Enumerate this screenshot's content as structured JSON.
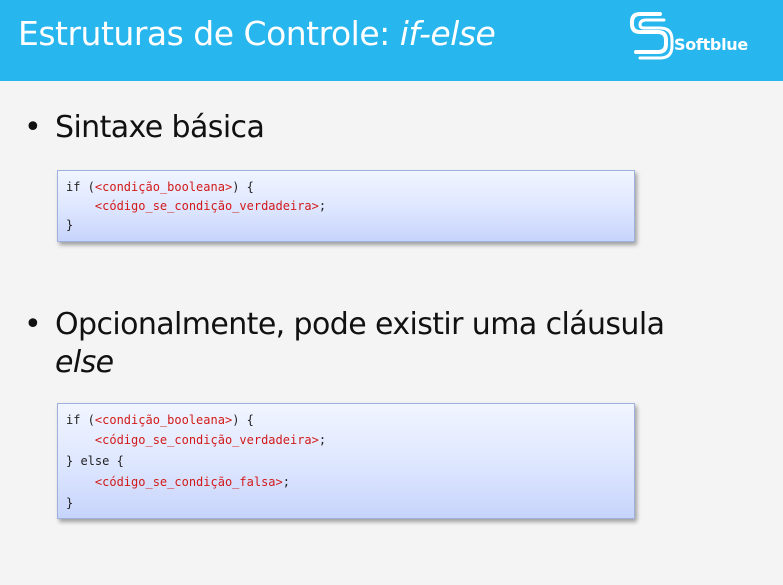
{
  "header": {
    "title_prefix": "Estruturas de Controle: ",
    "title_emphasis": "if-else",
    "logo_text": "Softblue",
    "background_color": "#27b6ee"
  },
  "bullets": [
    {
      "text": "Sintaxe básica"
    },
    {
      "text": "Opcionalmente, pode existir uma cláusula",
      "text_line2": "else"
    }
  ],
  "code_blocks": [
    {
      "lines": [
        {
          "a": "if (",
          "b": "<condição_booleana>",
          "c": ") {"
        },
        {
          "a": "    ",
          "b": "<código_se_condição_verdadeira>",
          "c": ";"
        },
        {
          "a": "}",
          "b": "",
          "c": ""
        }
      ]
    },
    {
      "lines": [
        {
          "a": "if (",
          "b": "<condição_booleana>",
          "c": ") {"
        },
        {
          "a": "    ",
          "b": "<código_se_condição_verdadeira>",
          "c": ";"
        },
        {
          "a": "} else {",
          "b": "",
          "c": ""
        },
        {
          "a": "    ",
          "b": "<código_se_condição_falsa>",
          "c": ";"
        },
        {
          "a": "}",
          "b": "",
          "c": ""
        }
      ]
    }
  ],
  "colors": {
    "code_highlight": "#d21a1a",
    "text": "#111111"
  }
}
